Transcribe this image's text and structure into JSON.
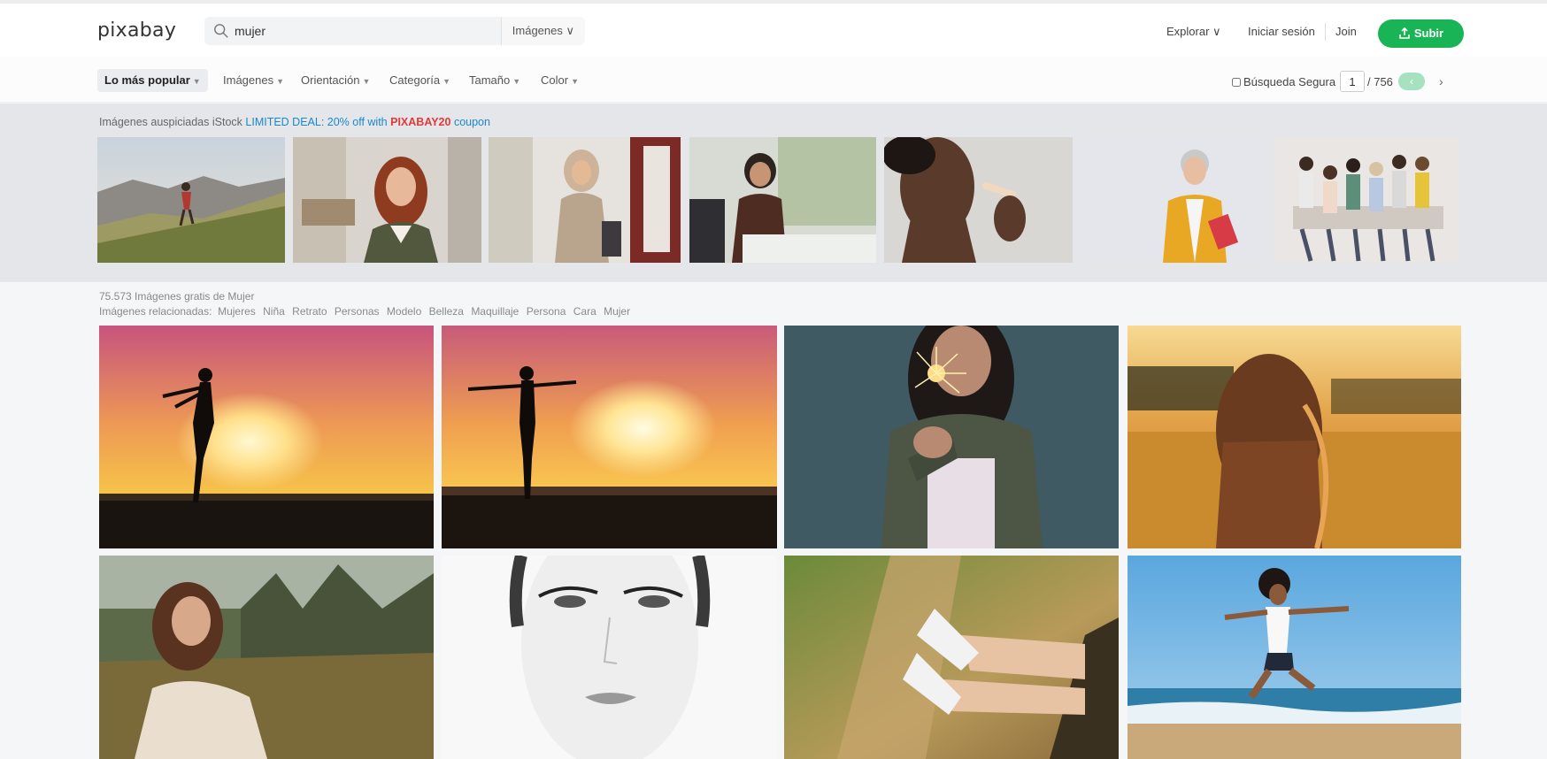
{
  "header": {
    "logo": "pixabay",
    "search": {
      "value": "mujer",
      "placeholder": "Buscar imágenes",
      "type_label": "Imágenes ∨"
    },
    "explore_label": "Explorar ∨",
    "login_label": "Iniciar sesión",
    "join_label": "Join",
    "upload_label": "Subir"
  },
  "filters": {
    "items": [
      "Lo más popular",
      "Imágenes",
      "Orientación",
      "Categoría",
      "Tamaño",
      "Color"
    ],
    "safe_search_label": "Búsqueda Segura",
    "page_current": "1",
    "page_total": "/ 756",
    "prev_label": "‹",
    "next_label": "›"
  },
  "sponsored": {
    "prefix": "Imágenes auspiciadas iStock",
    "deal": "LIMITED DEAL: 20% off with",
    "code": "PIXABAY20",
    "suffix": "coupon"
  },
  "results": {
    "count_text": "75.573 Imágenes gratis de Mujer",
    "related_label": "Imágenes relacionadas:",
    "related_tags": [
      "Mujeres",
      "Niña",
      "Retrato",
      "Personas",
      "Modelo",
      "Belleza",
      "Maquillaje",
      "Persona",
      "Cara",
      "Mujer"
    ]
  },
  "colors": {
    "brand_green": "#19b455",
    "deal_blue": "#1a87d0",
    "code_red": "#e23a3a"
  },
  "icons": {
    "search": "search-icon",
    "upload": "upload-icon"
  }
}
